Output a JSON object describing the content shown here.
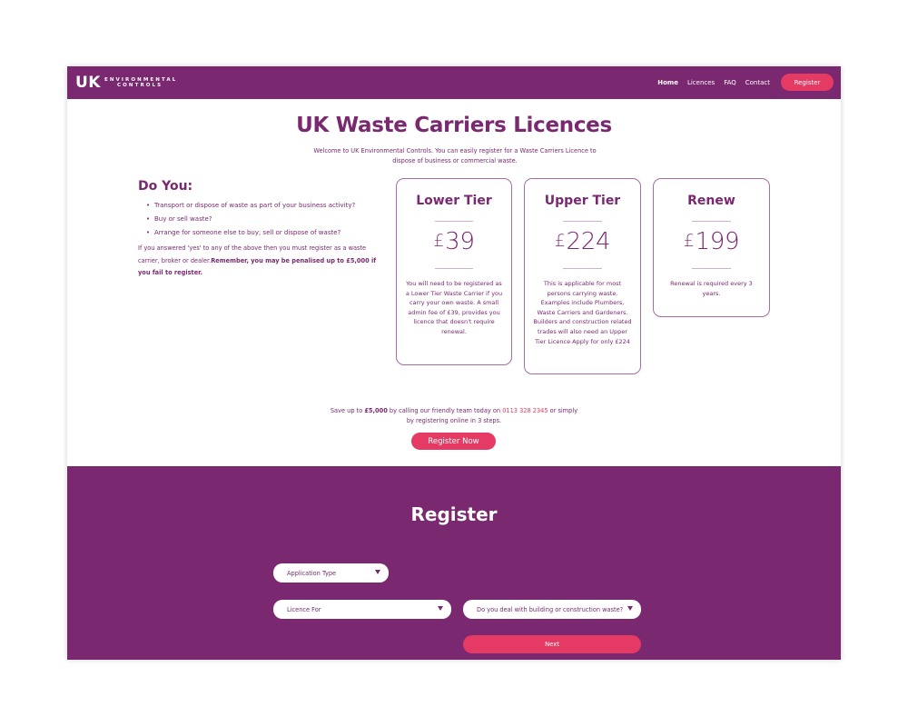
{
  "logo": {
    "uk": "UK",
    "line1": "ENVIRONMENTAL",
    "line2": "CONTROLS"
  },
  "nav": {
    "items": [
      "Home",
      "Licences",
      "FAQ",
      "Contact"
    ],
    "register_label": "Register"
  },
  "hero": {
    "title": "UK Waste Carriers Licences",
    "welcome": "Welcome to UK Environmental Controls. You can easily register for a Waste Carriers Licence to dispose of business or commercial waste."
  },
  "doyou": {
    "title": "Do You:",
    "items": [
      "Transport or dispose of waste as part of your business activity?",
      "Buy or sell waste?",
      "Arrange for someone else to buy, sell or dispose of waste?"
    ],
    "note": "If you answered 'yes' to any of the above then you must register as a waste carrier, broker or dealer.",
    "note_bold": "Remember, you may be penalised up to £5,000 if you fail to register."
  },
  "cards": [
    {
      "title": "Lower Tier",
      "currency": "£",
      "price": "39",
      "desc": "You will need to be registered as a Lower Tier Waste Carrier if you carry your own waste. A small admin fee of £39, provides you licence that doesn't require renewal."
    },
    {
      "title": "Upper Tier",
      "currency": "£",
      "price": "224",
      "desc": "This is applicable for most persons carrying waste. Examples include Plumbers, Waste Carriers and Gardeners. Builders and construction related trades will also need an Upper Tier Licence Apply for only £224"
    },
    {
      "title": "Renew",
      "currency": "£",
      "price": "199",
      "desc": "Renewal is required every 3 years."
    }
  ],
  "save": {
    "prefix": "Save up to ",
    "amount": "£5,000",
    "middle": " by calling our friendly team today on ",
    "phone": "0113 328 2345",
    "suffix": " or simply by registering online in 3 steps.",
    "button": "Register Now"
  },
  "register": {
    "title": "Register",
    "application_type": "Application Type",
    "licence_for": "Licence For",
    "construction_question": "Do you deal with building or construction waste?",
    "next_label": "Next"
  },
  "colors": {
    "brand_purple": "#7a2870",
    "accent_pink": "#e43a64"
  }
}
